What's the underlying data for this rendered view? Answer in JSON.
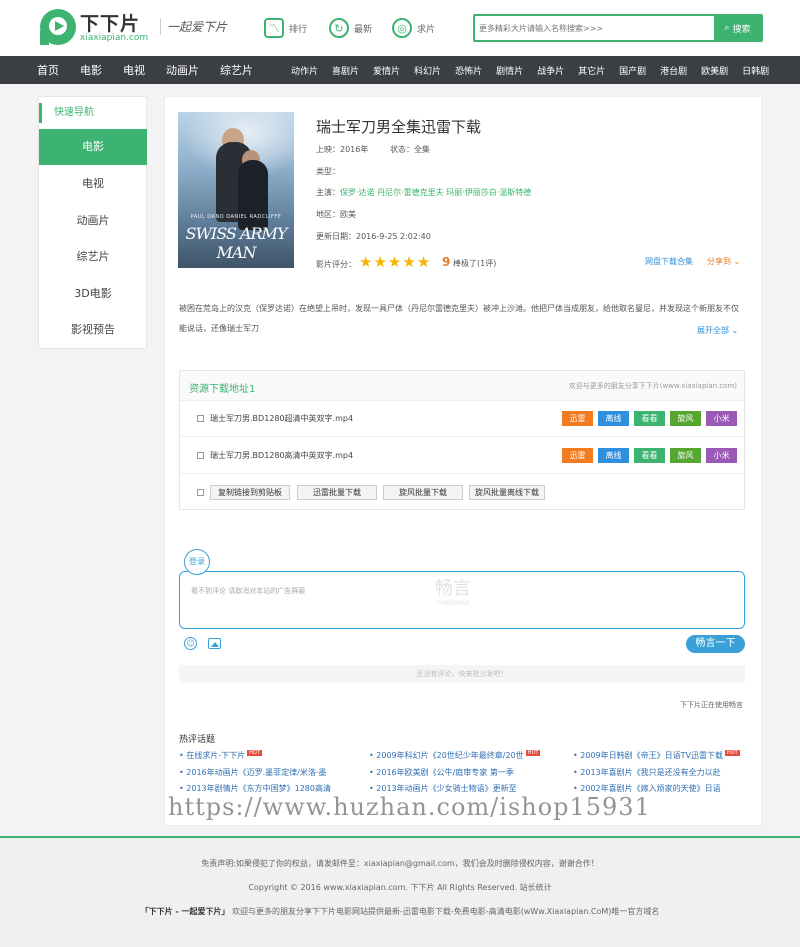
{
  "header": {
    "logo_name": "下下片",
    "logo_domain": "xiaxiapian.com",
    "slogan": "一起爱下片",
    "nav": [
      {
        "label": "排行",
        "icon": "chart-icon"
      },
      {
        "label": "最新",
        "icon": "refresh-icon"
      },
      {
        "label": "求片",
        "icon": "signal-icon"
      }
    ],
    "search_placeholder": "更多精彩大片请输入名称搜索>>>",
    "search_button": "搜索"
  },
  "nav": {
    "main": [
      "首页",
      "电影",
      "电视",
      "动画片",
      "综艺片"
    ],
    "categories": [
      "动作片",
      "喜剧片",
      "爱情片",
      "科幻片",
      "恐怖片",
      "剧情片",
      "战争片",
      "其它片",
      "国产剧",
      "港台剧",
      "欧美剧",
      "日韩剧"
    ]
  },
  "sidebar": {
    "title": "快速导航",
    "items": [
      "电影",
      "电视",
      "动画片",
      "综艺片",
      "3D电影",
      "影视预告"
    ]
  },
  "movie": {
    "poster_title": "SWISS ARMY MAN",
    "poster_names": "PAUL DANO   DANIEL RADCLIFFE",
    "title": "瑞士军刀男全集迅雷下载",
    "release_label": "上映：",
    "release": "2016年",
    "status_label": "状态：",
    "status": "全集",
    "type_label": "类型：",
    "cast_label": "主演：",
    "cast": "保罗·达诺  丹尼尔·雷德克里夫  玛丽·伊丽莎白·温斯特德",
    "region_label": "地区：",
    "region": "欧美",
    "updated_label": "更新日期：",
    "updated": "2016-9-25 2:02:40",
    "rating_label": "影片评分：",
    "rating_stars": 5,
    "score": "9",
    "score_text": "棒极了(1评)",
    "netdisk": "网盘下载合集",
    "share": "分享到 ⌄",
    "desc": "被困在荒岛上的汉克（保罗达诺）在绝望上吊时，发现一具尸体（丹尼尔雷德克里夫）被冲上沙滩。他把尸体当成朋友，给他取名曼尼，并发现这个新朋友不仅能说话，还像瑞士军刀",
    "expand": "展开全部 ⌄"
  },
  "download": {
    "title": "资源下载地址1",
    "note": "欢迎与更多的朋友分享下下片(www.xiaxiapian.com)",
    "rows": [
      {
        "file": "瑞士军刀男.BD1280超清中英双字.mp4"
      },
      {
        "file": "瑞士军刀男.BD1280高清中英双字.mp4"
      }
    ],
    "tags": [
      "迅雷",
      "离线",
      "看看",
      "旋风",
      "小米"
    ],
    "batch_buttons": [
      "复制链接到剪贴板",
      "迅雷批量下载",
      "旋风批量下载",
      "旋风批量离线下载"
    ]
  },
  "comment": {
    "login": "登录",
    "placeholder": "看不到评论 请取消对本站的广告屏蔽",
    "watermark": "畅言",
    "watermark_en": "CHANGYAN",
    "post_button": "畅言一下",
    "empty": "还没有评论，快来抢沙发吧！",
    "using": "下下片正在使用畅言",
    "hot_title": "热评话题",
    "hot": [
      {
        "text": "在线求片-下下片",
        "hot": true
      },
      {
        "text": "2009年科幻片《20世纪少年最终章/20世",
        "hot": true
      },
      {
        "text": "2009年日韩剧《帝王》日语TV迅雷下载",
        "hot": true
      },
      {
        "text": "2016年动画片《迈罗.墨菲定律/米洛·墨",
        "hot": false
      },
      {
        "text": "2016年欧美剧《公牛/庭审专家 第一季",
        "hot": false
      },
      {
        "text": "2013年喜剧片《我只是还没有全力以赴",
        "hot": false
      },
      {
        "text": "2013年剧情片《东方中国梦》1280高清",
        "hot": false
      },
      {
        "text": "2013年动画片《少女骑士物语》更新至",
        "hot": false
      },
      {
        "text": "2002年喜剧片《嫁入烦家的天使》日语",
        "hot": false
      }
    ],
    "hot_tag": "HOT"
  },
  "watermark": "https://www.huzhan.com/ishop15931",
  "footer": {
    "disclaimer": "免责声明:如果侵犯了你的权益，请发邮件至：xiaxiapian@gmail.com，我们会及时删除侵权内容，谢谢合作！",
    "copyright": "Copyright © 2016 www.xiaxiapian.com. 下下片 All Rights Reserved. 站长统计",
    "brand": "「下下片 - 一起爱下片」",
    "tagline": "欢迎与更多的朋友分享下下片电影网站提供最新-迅雷电影下载-免费电影-高清电影(wWw.Xiaxiapian.CoM)唯一官方域名"
  },
  "colors": {
    "accent": "#3cb371",
    "nav_bg": "#3b3f44",
    "link": "#2f8fd8",
    "changyan": "#3aa0d8"
  }
}
